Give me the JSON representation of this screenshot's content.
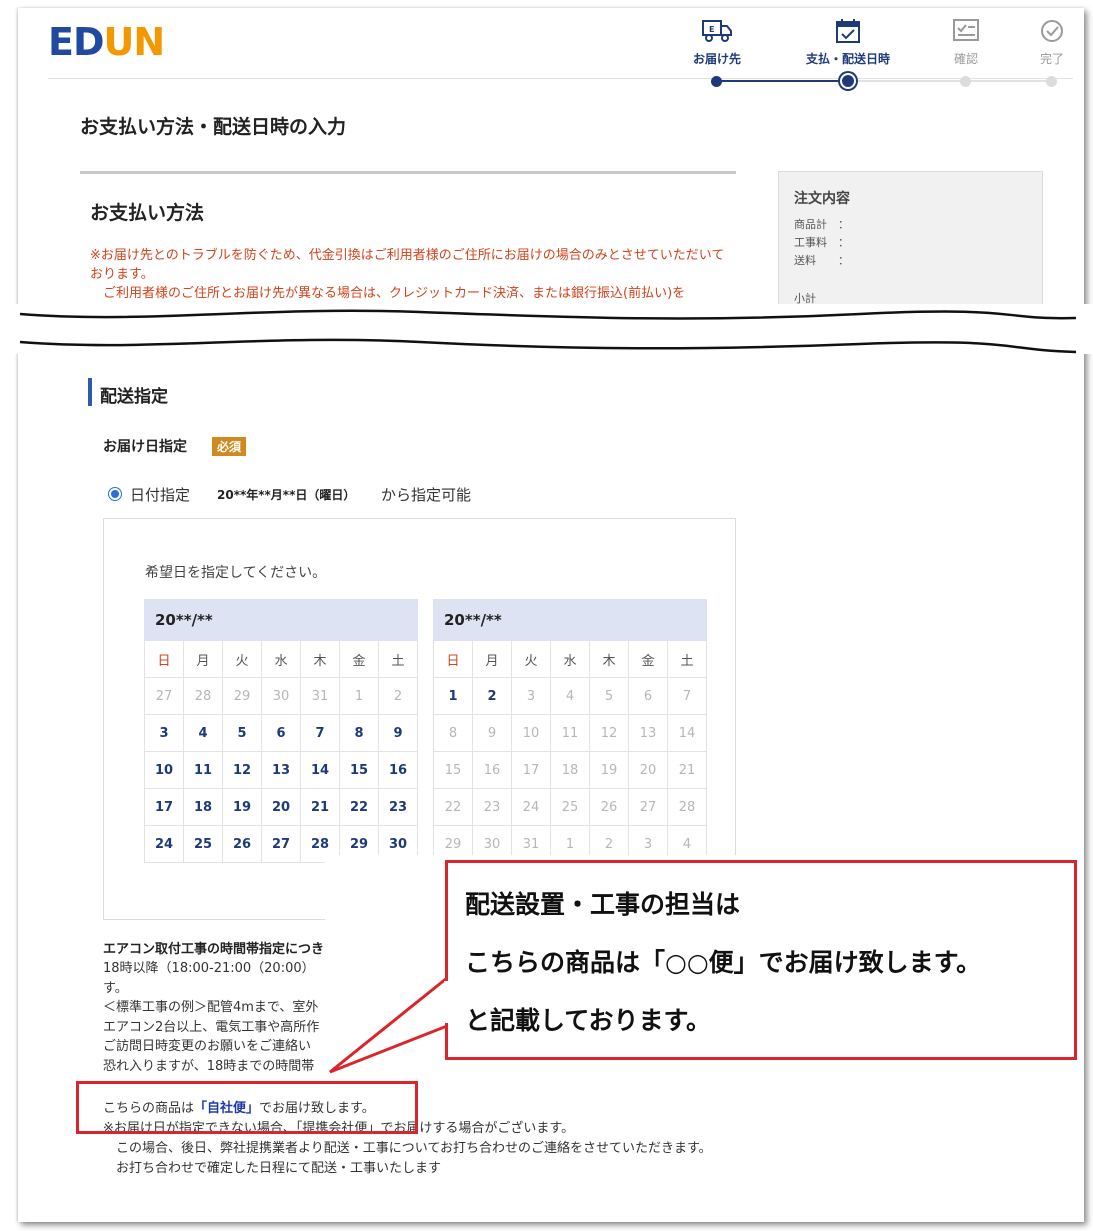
{
  "header": {
    "logo_ed": "ED",
    "logo_u": "U",
    "logo_n": "N",
    "steps": [
      {
        "label": "お届け先",
        "icon": "truck-icon",
        "state": "done"
      },
      {
        "label": "支払・配送日時",
        "icon": "calendar-check-icon",
        "state": "current"
      },
      {
        "label": "確認",
        "icon": "document-icon",
        "state": "pending"
      },
      {
        "label": "完了",
        "icon": "check-circle-icon",
        "state": "pending"
      }
    ]
  },
  "colors": {
    "brand_blue": "#1f4aa0",
    "brand_orange": "#f39800",
    "accent_red": "#d9252b",
    "notice_red": "#d2431c"
  },
  "page_title": "お支払い方法・配送日時の入力",
  "payment": {
    "title": "お支払い方法",
    "note_1": "※お届け先とのトラブルを防ぐため、代金引換はご利用者様のご住所にお届けの場合のみとさせていただいております。",
    "note_2": "ご利用者様のご住所とお届け先が異なる場合は、クレジットカード決済、または銀行振込(前払い)を"
  },
  "order_summary": {
    "title": "注文内容",
    "rows": [
      "商品計　：",
      "工事料　：",
      "送料　　：",
      "小計"
    ]
  },
  "shipping": {
    "title": "配送指定",
    "date_label": "お届け日指定",
    "required": "必須",
    "radio_label": "日付指定",
    "date_value": "20**年**月**日（曜日）",
    "date_suffix": "から指定可能",
    "hint": "希望日を指定してください。",
    "weekdays": [
      "日",
      "月",
      "火",
      "水",
      "木",
      "金",
      "土"
    ],
    "calendars": [
      {
        "month": "20**/**",
        "weeks": [
          [
            {
              "d": "27",
              "on": false
            },
            {
              "d": "28",
              "on": false
            },
            {
              "d": "29",
              "on": false
            },
            {
              "d": "30",
              "on": false
            },
            {
              "d": "31",
              "on": false
            },
            {
              "d": "1",
              "on": false
            },
            {
              "d": "2",
              "on": false
            }
          ],
          [
            {
              "d": "3",
              "on": true
            },
            {
              "d": "4",
              "on": true
            },
            {
              "d": "5",
              "on": true
            },
            {
              "d": "6",
              "on": true
            },
            {
              "d": "7",
              "on": true
            },
            {
              "d": "8",
              "on": true
            },
            {
              "d": "9",
              "on": true
            }
          ],
          [
            {
              "d": "10",
              "on": true
            },
            {
              "d": "11",
              "on": true
            },
            {
              "d": "12",
              "on": true
            },
            {
              "d": "13",
              "on": true
            },
            {
              "d": "14",
              "on": true
            },
            {
              "d": "15",
              "on": true
            },
            {
              "d": "16",
              "on": true
            }
          ],
          [
            {
              "d": "17",
              "on": true
            },
            {
              "d": "18",
              "on": true
            },
            {
              "d": "19",
              "on": true
            },
            {
              "d": "20",
              "on": true
            },
            {
              "d": "21",
              "on": true
            },
            {
              "d": "22",
              "on": true
            },
            {
              "d": "23",
              "on": true
            }
          ],
          [
            {
              "d": "24",
              "on": true
            },
            {
              "d": "25",
              "on": true
            },
            {
              "d": "26",
              "on": true
            },
            {
              "d": "27",
              "on": true
            },
            {
              "d": "28",
              "on": true
            },
            {
              "d": "29",
              "on": true
            },
            {
              "d": "30",
              "on": true
            }
          ]
        ]
      },
      {
        "month": "20**/**",
        "weeks": [
          [
            {
              "d": "1",
              "on": true
            },
            {
              "d": "2",
              "on": true
            },
            {
              "d": "3",
              "on": false
            },
            {
              "d": "4",
              "on": false
            },
            {
              "d": "5",
              "on": false
            },
            {
              "d": "6",
              "on": false
            },
            {
              "d": "7",
              "on": false
            }
          ],
          [
            {
              "d": "8",
              "on": false
            },
            {
              "d": "9",
              "on": false
            },
            {
              "d": "10",
              "on": false
            },
            {
              "d": "11",
              "on": false
            },
            {
              "d": "12",
              "on": false
            },
            {
              "d": "13",
              "on": false
            },
            {
              "d": "14",
              "on": false
            }
          ],
          [
            {
              "d": "15",
              "on": false
            },
            {
              "d": "16",
              "on": false
            },
            {
              "d": "17",
              "on": false
            },
            {
              "d": "18",
              "on": false
            },
            {
              "d": "19",
              "on": false
            },
            {
              "d": "20",
              "on": false
            },
            {
              "d": "21",
              "on": false
            }
          ],
          [
            {
              "d": "22",
              "on": false
            },
            {
              "d": "23",
              "on": false
            },
            {
              "d": "24",
              "on": false
            },
            {
              "d": "25",
              "on": false
            },
            {
              "d": "26",
              "on": false
            },
            {
              "d": "27",
              "on": false
            },
            {
              "d": "28",
              "on": false
            }
          ],
          [
            {
              "d": "29",
              "on": false
            },
            {
              "d": "30",
              "on": false
            },
            {
              "d": "31",
              "on": false
            },
            {
              "d": "1",
              "on": false
            },
            {
              "d": "2",
              "on": false
            },
            {
              "d": "3",
              "on": false
            },
            {
              "d": "4",
              "on": false
            }
          ]
        ]
      }
    ]
  },
  "aircon_notice": {
    "title": "エアコン取付工事の時間帯指定につき",
    "lines": [
      "18時以降（18:00-21:00（20:00）",
      "す。",
      "＜標準工事の例＞配管4mまで、室外",
      "エアコン2台以上、電気工事や高所作",
      "ご訪問日時変更のお願いをご連絡い",
      "恐れ入りますが、18時までの時間帯"
    ]
  },
  "delivery_notice": {
    "prefix": "こちらの商品は",
    "carrier": "「自社便」",
    "suffix": "でお届け致します。",
    "line_2": "※お届け日が指定できない場合、「提携会社便」でお届けする場合がございます。",
    "line_3": "　この場合、後日、弊社提携業者より配送・工事についてお打ち合わせのご連絡をさせていただきます。",
    "line_4": "　お打ち合わせで確定した日程にて配送・工事いたします"
  },
  "callout": {
    "line_1": "配送設置・工事の担当は",
    "line_2": "こちらの商品は「○○便」でお届け致します。",
    "line_3": "と記載しております。"
  }
}
